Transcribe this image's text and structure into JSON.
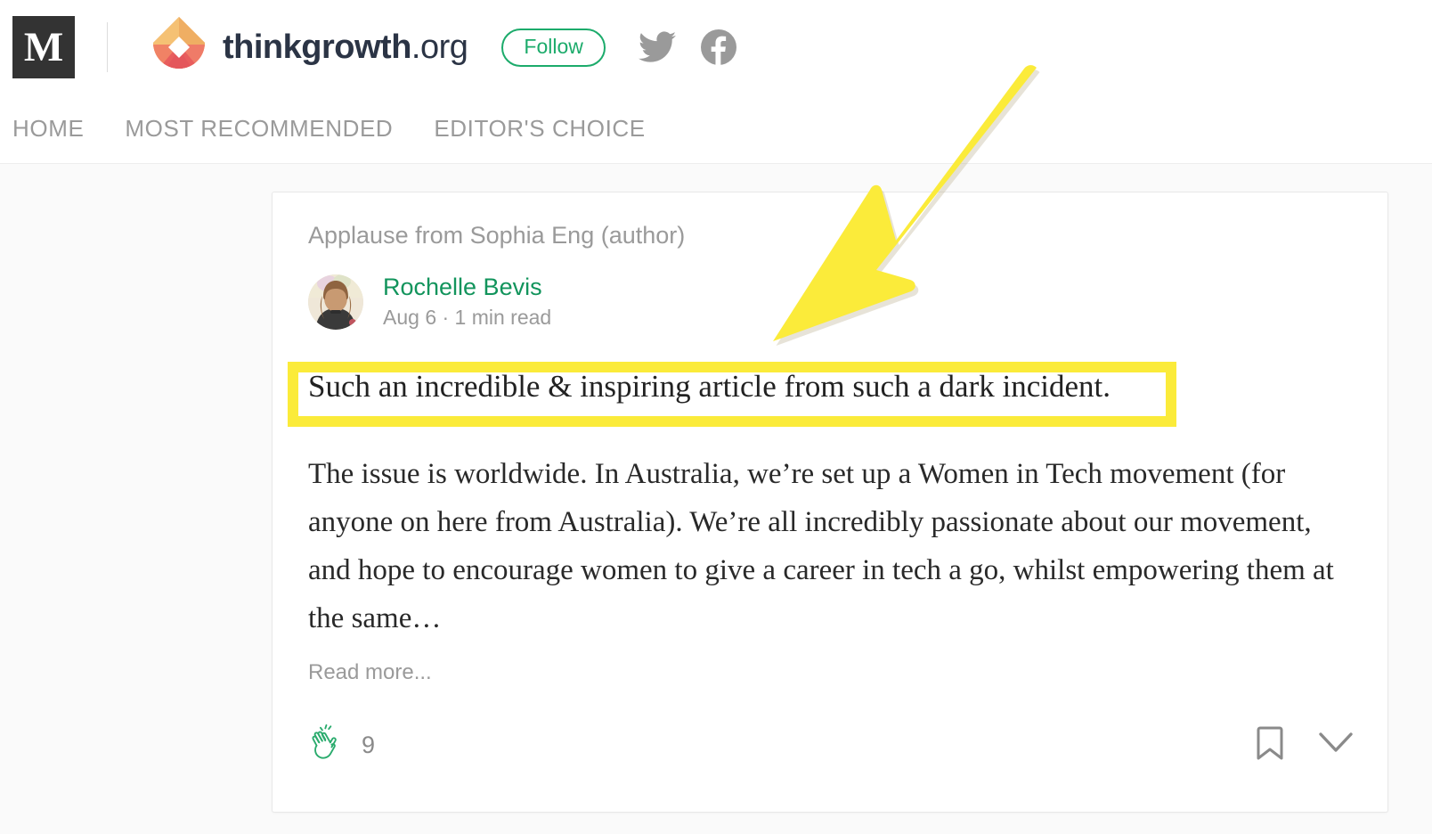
{
  "header": {
    "medium_logo_glyph": "M",
    "publication_name_main": "thinkgrowth",
    "publication_name_tld": ".org",
    "follow_label": "Follow",
    "twitter_icon": "twitter-icon",
    "facebook_icon": "facebook-icon",
    "logo_icon": "thinkgrowth-diamond-logo",
    "accent_green": "#1cab6b"
  },
  "nav": {
    "items": [
      {
        "label": "HOME"
      },
      {
        "label": "MOST RECOMMENDED"
      },
      {
        "label": "EDITOR'S CHOICE"
      }
    ]
  },
  "card": {
    "applause_line": "Applause from Sophia Eng (author)",
    "author_name": "Rochelle Bevis",
    "post_meta": "Aug 6 · 1 min read",
    "title": "Such an incredible & inspiring article from such a dark incident.",
    "body": "The issue is worldwide. In Australia, we’re set up a Women in Tech movement (for anyone on here from Australia). We’re all incredibly passionate about our movement, and hope to encourage women to give a career in tech a go, whilst empowering them at the same…",
    "read_more": "Read more...",
    "clap_count": "9",
    "clap_icon": "clap-icon",
    "bookmark_icon": "bookmark-icon",
    "chevron_down_icon": "chevron-down-icon",
    "author_link_color": "#12945c",
    "clap_color": "#2aab6d"
  },
  "annotation": {
    "arrow_color": "#fbeb3a",
    "highlight_color": "#fbeb3a",
    "arrow_icon": "yellow-pointer-arrow",
    "highlight_target": "post-title"
  }
}
